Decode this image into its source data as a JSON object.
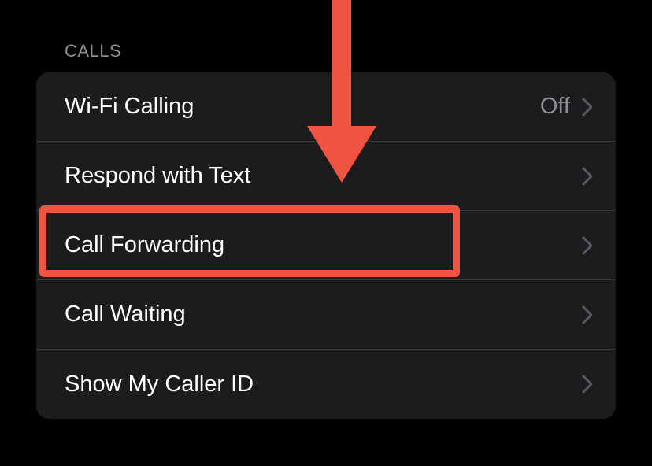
{
  "section": {
    "header": "CALLS",
    "rows": [
      {
        "label": "Wi-Fi Calling",
        "value": "Off"
      },
      {
        "label": "Respond with Text",
        "value": ""
      },
      {
        "label": "Call Forwarding",
        "value": ""
      },
      {
        "label": "Call Waiting",
        "value": ""
      },
      {
        "label": "Show My Caller ID",
        "value": ""
      }
    ]
  }
}
